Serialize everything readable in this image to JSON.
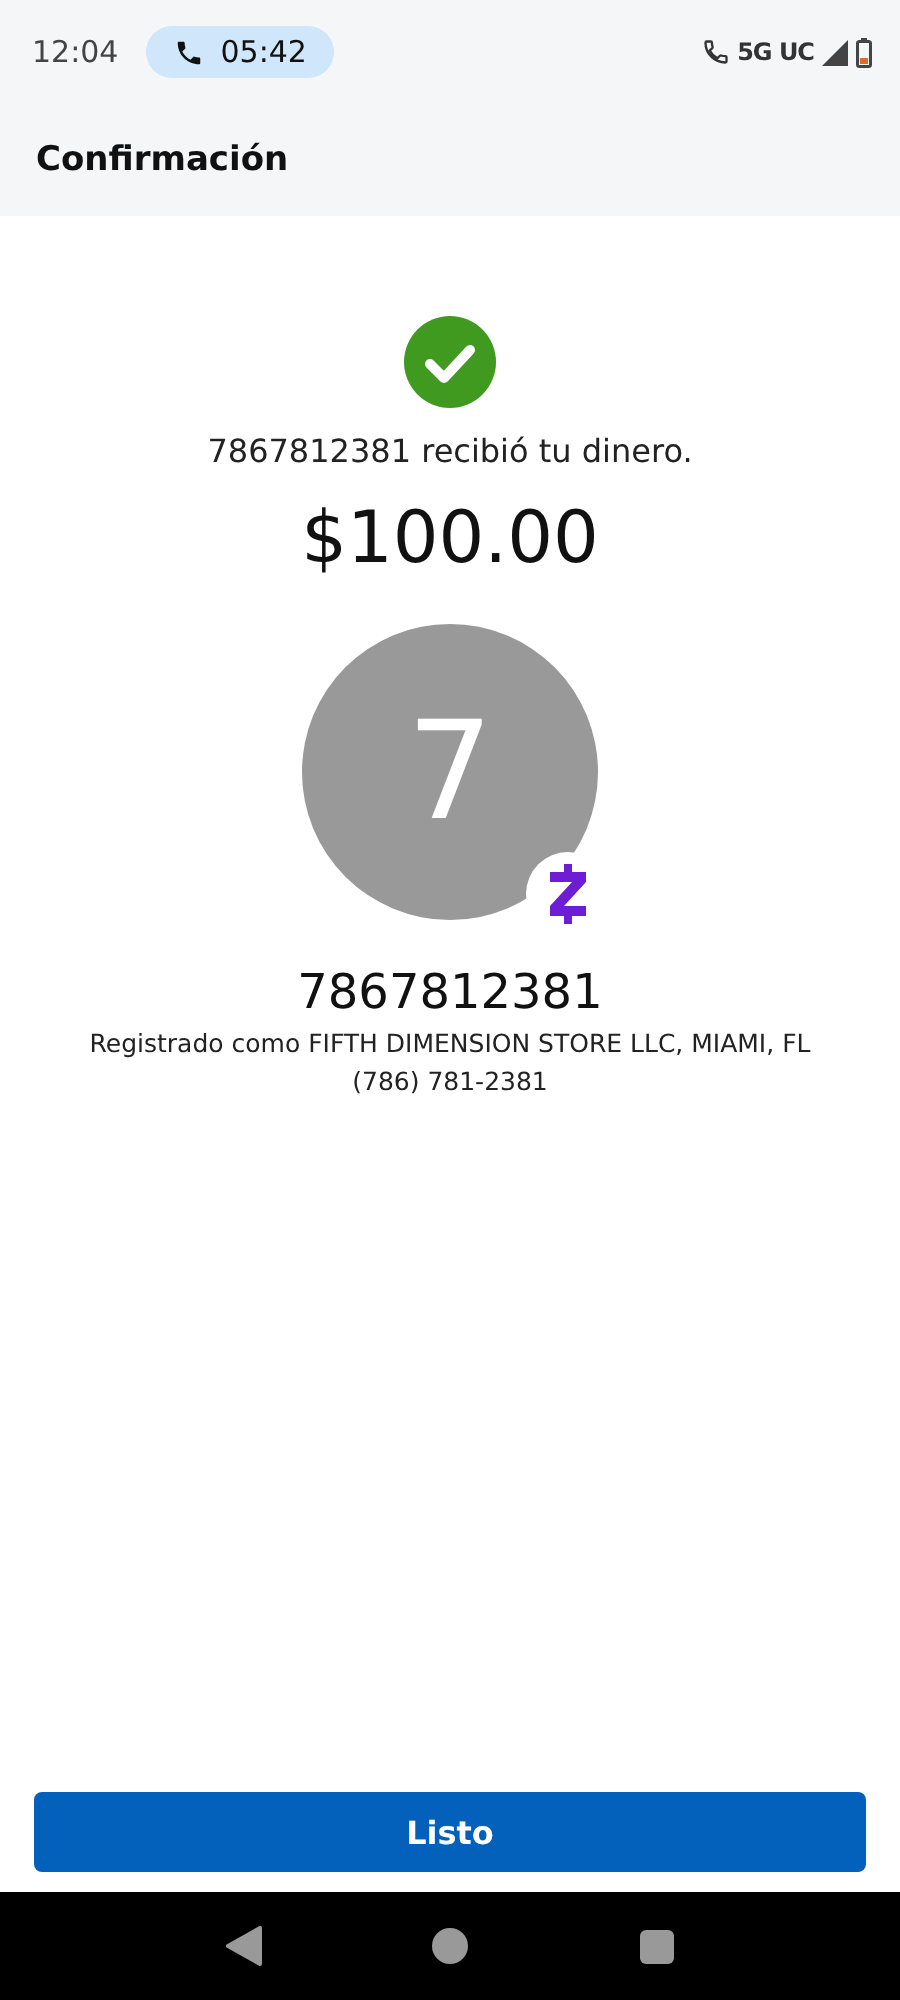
{
  "status_bar": {
    "time": "12:04",
    "call_timer": "05:42",
    "network": "5G UC"
  },
  "header": {
    "title": "Confirmación"
  },
  "confirmation": {
    "message": "7867812381 recibió tu dinero.",
    "amount": "$100.00",
    "avatar_initial": "7",
    "recipient": "7867812381",
    "registered_as": "Registrado como FIFTH DIMENSION STORE LLC, MIAMI, FL",
    "phone": "(786) 781-2381"
  },
  "primary_button": {
    "label": "Listo"
  }
}
